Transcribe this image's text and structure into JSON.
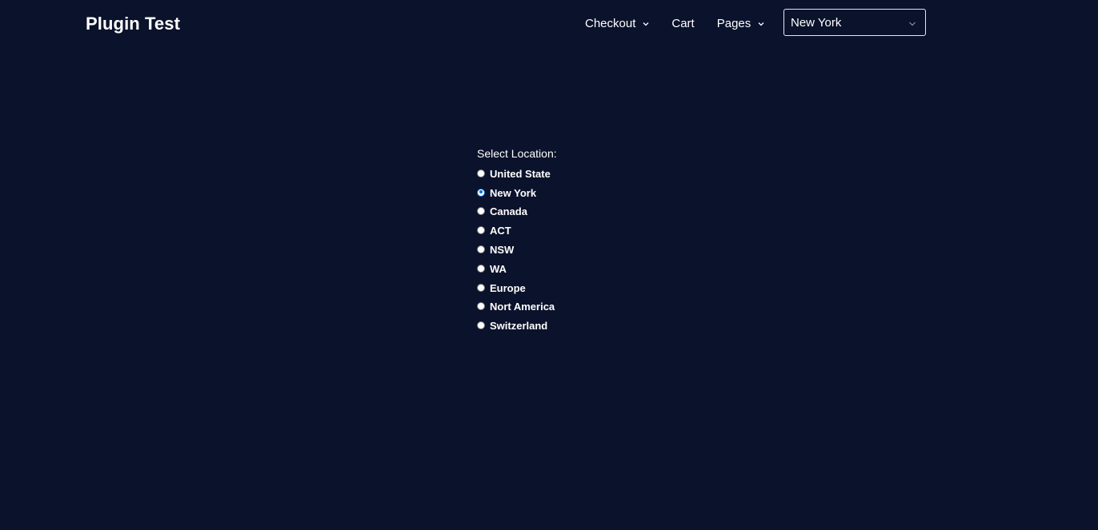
{
  "header": {
    "site_title": "Plugin Test",
    "nav": [
      {
        "label": "Checkout",
        "has_dropdown": true
      },
      {
        "label": "Cart",
        "has_dropdown": false
      },
      {
        "label": "Pages",
        "has_dropdown": true
      }
    ],
    "location_select": {
      "selected": "New York"
    }
  },
  "form": {
    "label": "Select Location:",
    "options": [
      {
        "label": "United State",
        "checked": false
      },
      {
        "label": "New York",
        "checked": true
      },
      {
        "label": "Canada",
        "checked": false
      },
      {
        "label": "ACT",
        "checked": false
      },
      {
        "label": "NSW",
        "checked": false
      },
      {
        "label": "WA",
        "checked": false
      },
      {
        "label": "Europe",
        "checked": false
      },
      {
        "label": "Nort America",
        "checked": false
      },
      {
        "label": "Switzerland",
        "checked": false
      }
    ]
  },
  "colors": {
    "background": "#0b122b",
    "text": "#ffffff",
    "radio_selected": "#0a75d8"
  },
  "icons": {
    "nav_dropdown": "chevron-down-icon",
    "select_dropdown": "chevron-down-icon"
  }
}
